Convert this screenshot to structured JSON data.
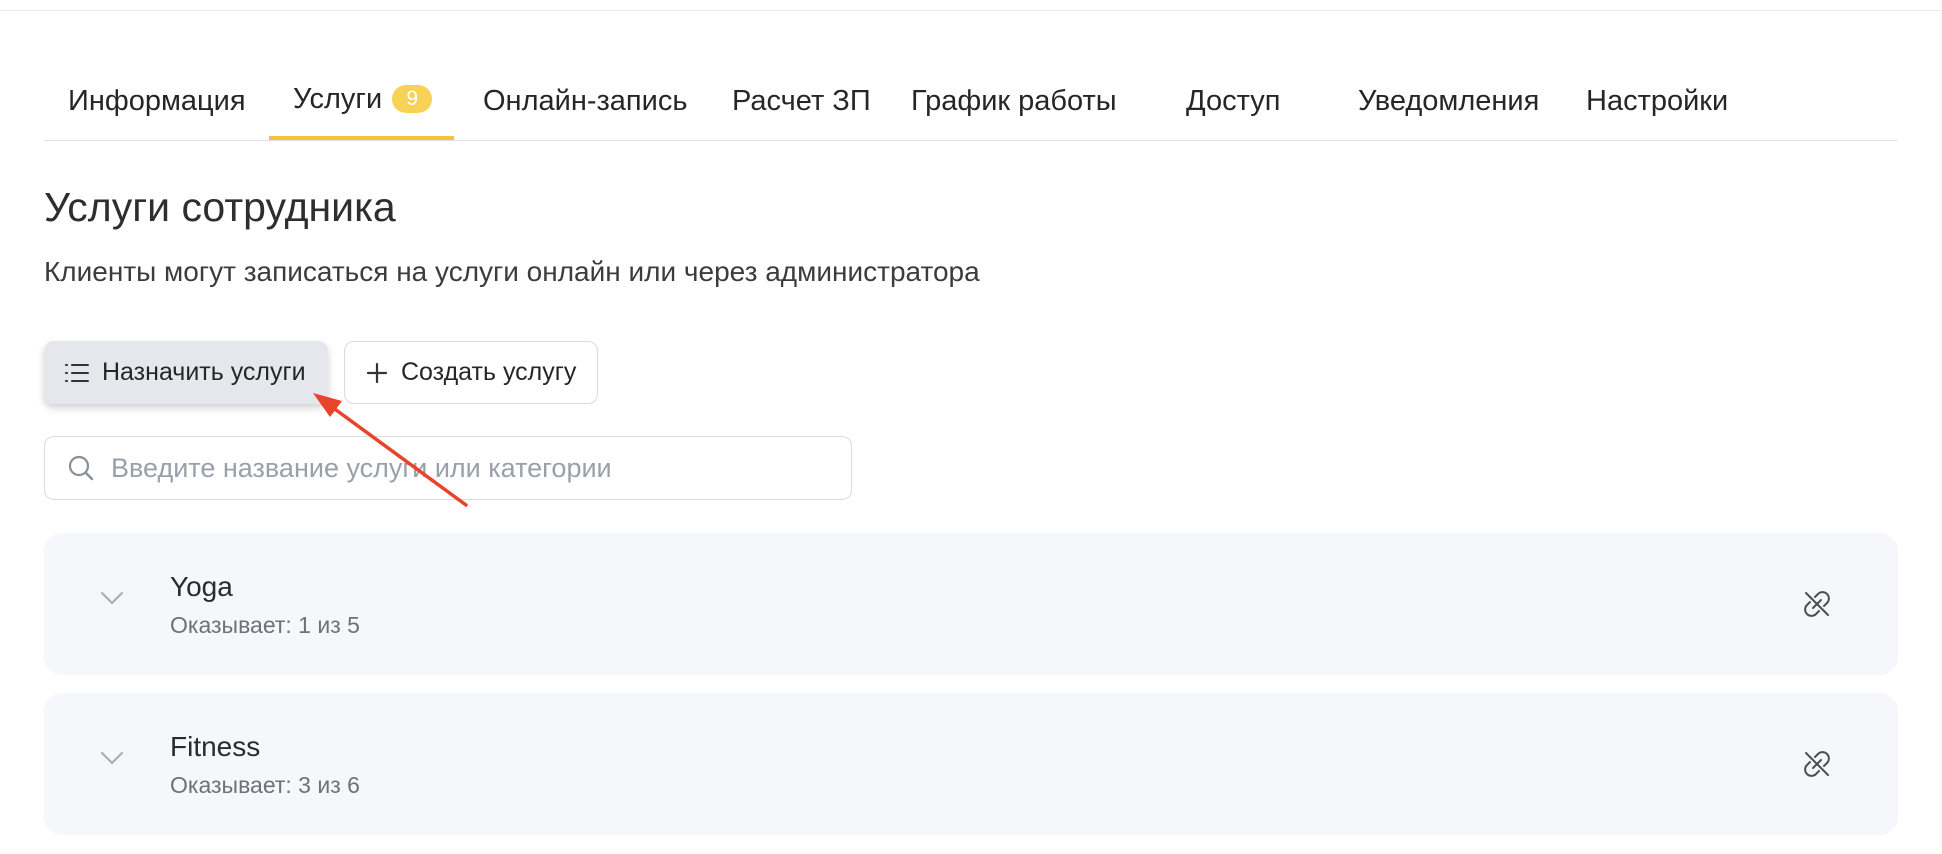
{
  "tabs": [
    {
      "label": "Информация"
    },
    {
      "label": "Услуги",
      "count": "9",
      "active": true
    },
    {
      "label": "Онлайн-запись"
    },
    {
      "label": "Расчет ЗП"
    },
    {
      "label": "График работы"
    },
    {
      "label": "Доступ"
    },
    {
      "label": "Уведомления"
    },
    {
      "label": "Настройки"
    }
  ],
  "page": {
    "title": "Услуги сотрудника",
    "subtitle": "Клиенты могут записаться на услуги онлайн или через администратора"
  },
  "actions": {
    "assign_label": "Назначить услуги",
    "create_label": "Создать услугу"
  },
  "search": {
    "value": "",
    "placeholder": "Введите название услуги или категории"
  },
  "categories": [
    {
      "name": "Yoga",
      "meta": "Оказывает: 1 из 5"
    },
    {
      "name": "Fitness",
      "meta": "Оказывает: 3 из 6"
    }
  ],
  "colors": {
    "accent": "#f4c33c",
    "badge": "#f8d256",
    "annotation_arrow": "#e8432b"
  },
  "icons": [
    "list-icon",
    "plus-icon",
    "search-icon",
    "chevron-down-icon",
    "unlink-icon"
  ]
}
